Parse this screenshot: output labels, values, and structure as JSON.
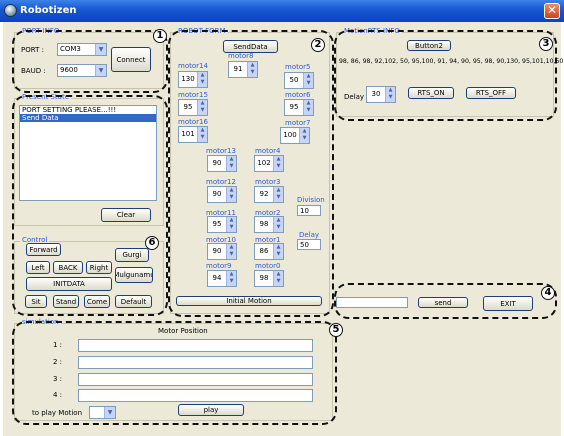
{
  "window": {
    "title": "Robotizen",
    "close_glyph": "✕"
  },
  "port_info": {
    "title": "PORT INFO",
    "port_label": "PORT :",
    "port_value": "COM3",
    "baud_label": "BAUD :",
    "baud_value": "9600",
    "connect_label": "Connect",
    "badge": "1"
  },
  "present_state": {
    "title": "Present State",
    "items": [
      "PORT SETTING PLEASE...!!!",
      "Send Data"
    ],
    "clear_label": "Clear"
  },
  "control": {
    "title": "Control",
    "forward": "Forward",
    "gurgi": "Gurgi",
    "left": "Left",
    "back": "BACK",
    "right": "Right",
    "mulgunamu": "Mulgunamu",
    "initdata": "INITDATA",
    "sit": "Sit",
    "stand": "Stand",
    "come": "Come",
    "default": "Default",
    "badge": "6"
  },
  "robot_form": {
    "title": "ROBOT FORM",
    "senddata_label": "SendData",
    "initial_motion_label": "Initial Motion",
    "division_label": "Division",
    "division_value": "10",
    "delay_label": "Delay",
    "delay_value": "50",
    "badge": "2",
    "motors": {
      "m0": {
        "label": "motor0",
        "value": "98"
      },
      "m1": {
        "label": "motor1",
        "value": "86"
      },
      "m2": {
        "label": "motor2",
        "value": "98"
      },
      "m3": {
        "label": "motor3",
        "value": "92"
      },
      "m4": {
        "label": "motor4",
        "value": "102"
      },
      "m5": {
        "label": "motor5",
        "value": "50"
      },
      "m6": {
        "label": "motor6",
        "value": "95"
      },
      "m7": {
        "label": "motor7",
        "value": "100"
      },
      "m8": {
        "label": "motor8",
        "value": "91"
      },
      "m9": {
        "label": "motor9",
        "value": "94"
      },
      "m10": {
        "label": "motor10",
        "value": "90"
      },
      "m11": {
        "label": "motor11",
        "value": "95"
      },
      "m12": {
        "label": "motor12",
        "value": "90"
      },
      "m13": {
        "label": "motor13",
        "value": "90"
      },
      "m14": {
        "label": "motor14",
        "value": "130"
      },
      "m15": {
        "label": "motor15",
        "value": "95"
      },
      "m16": {
        "label": "motor16",
        "value": "101"
      }
    }
  },
  "motion_rts": {
    "title": "MotionRTS INFO",
    "button2_label": "Button2",
    "data_text": "98, 86, 98, 92,102, 50, 95,100, 91, 94, 90, 95, 98, 90,130, 95,101,10,50",
    "delay_label": "Delay",
    "delay_value": "30",
    "rts_on_label": "RTS_ON",
    "rts_off_label": "RTS_OFF",
    "badge": "3"
  },
  "send_area": {
    "send_label": "send",
    "exit_label": "EXIT",
    "input_value": "",
    "badge": "4"
  },
  "simulation": {
    "title": "simulation",
    "motor_position_label": "Motor Position",
    "rows": [
      {
        "label": "1 :",
        "value": ""
      },
      {
        "label": "2 :",
        "value": ""
      },
      {
        "label": "3 :",
        "value": ""
      },
      {
        "label": "4 :",
        "value": ""
      }
    ],
    "to_play_label": "to play Motion",
    "play_value": "",
    "play_label": "play",
    "badge": "5"
  }
}
